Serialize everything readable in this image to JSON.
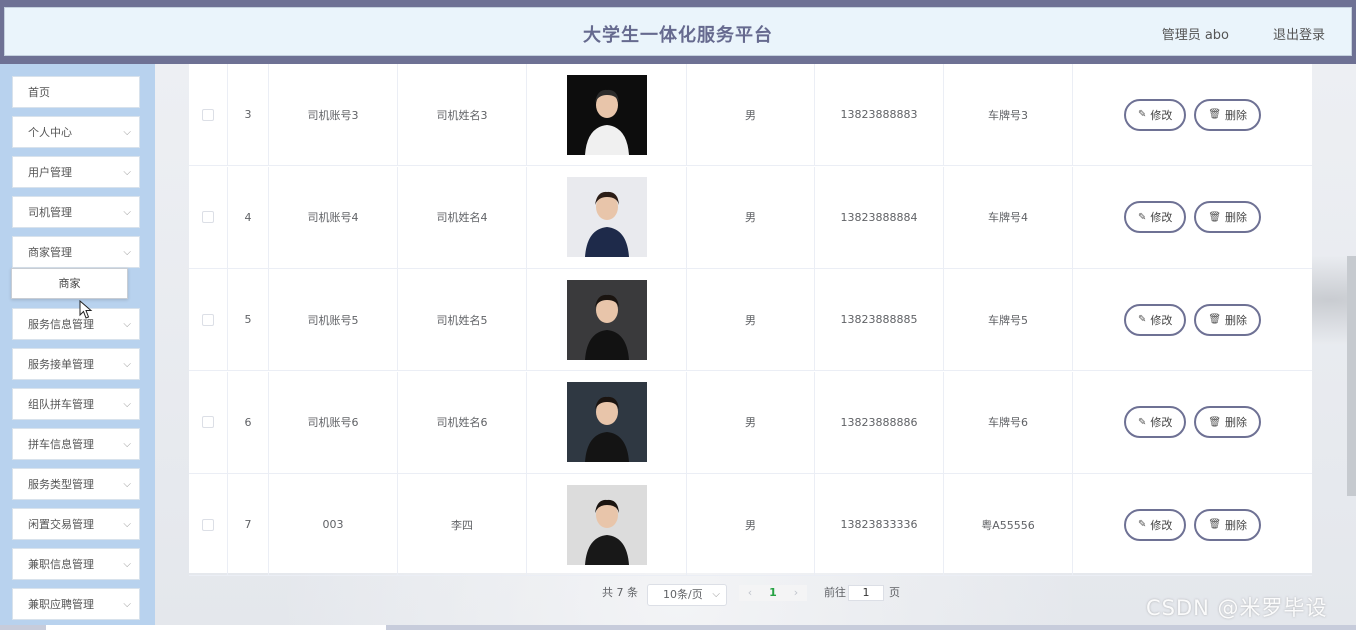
{
  "header": {
    "title": "大学生一体化服务平台",
    "user": "管理员 abo",
    "logout": "退出登录"
  },
  "sidebar": {
    "items": [
      {
        "label": "首页",
        "has_chevron": false
      },
      {
        "label": "个人中心",
        "has_chevron": true
      },
      {
        "label": "用户管理",
        "has_chevron": true
      },
      {
        "label": "司机管理",
        "has_chevron": true
      },
      {
        "label": "商家管理",
        "has_chevron": true
      },
      {
        "label": "服务信息管理",
        "has_chevron": true
      },
      {
        "label": "服务接单管理",
        "has_chevron": true
      },
      {
        "label": "组队拼车管理",
        "has_chevron": true
      },
      {
        "label": "拼车信息管理",
        "has_chevron": true
      },
      {
        "label": "服务类型管理",
        "has_chevron": true
      },
      {
        "label": "闲置交易管理",
        "has_chevron": true
      },
      {
        "label": "兼职信息管理",
        "has_chevron": true
      },
      {
        "label": "兼职应聘管理",
        "has_chevron": true
      }
    ],
    "submenu_item": "商家"
  },
  "table": {
    "rows": [
      {
        "index": "3",
        "account": "司机账号3",
        "name": "司机姓名3",
        "gender": "男",
        "phone": "13823888883",
        "plate": "车牌号3",
        "photo": "man-white-coat"
      },
      {
        "index": "4",
        "account": "司机账号4",
        "name": "司机姓名4",
        "gender": "男",
        "phone": "13823888884",
        "plate": "车牌号4",
        "photo": "woman-portrait"
      },
      {
        "index": "5",
        "account": "司机账号5",
        "name": "司机姓名5",
        "gender": "男",
        "phone": "13823888885",
        "plate": "车牌号5",
        "photo": "woman-black-dress"
      },
      {
        "index": "6",
        "account": "司机账号6",
        "name": "司机姓名6",
        "gender": "男",
        "phone": "13823888886",
        "plate": "车牌号6",
        "photo": "woman-suit"
      },
      {
        "index": "7",
        "account": "003",
        "name": "李四",
        "gender": "男",
        "phone": "13823833336",
        "plate": "粤A55556",
        "photo": "man-suit"
      }
    ],
    "edit_label": "修改",
    "delete_label": "删除",
    "edit_icon": "pencil-icon",
    "delete_icon": "trash-icon"
  },
  "pagination": {
    "total": "共 7 条",
    "page_size": "10条/页",
    "current_page": "1",
    "goto_label": "前往",
    "goto_value": "1",
    "page_suffix": "页"
  },
  "watermark": "CSDN @米罗毕设",
  "colors": {
    "header_bg": "#6e7194",
    "title": "#666a8f",
    "sidebar_bg": "#b8d2ee",
    "current_page": "#26a243"
  }
}
